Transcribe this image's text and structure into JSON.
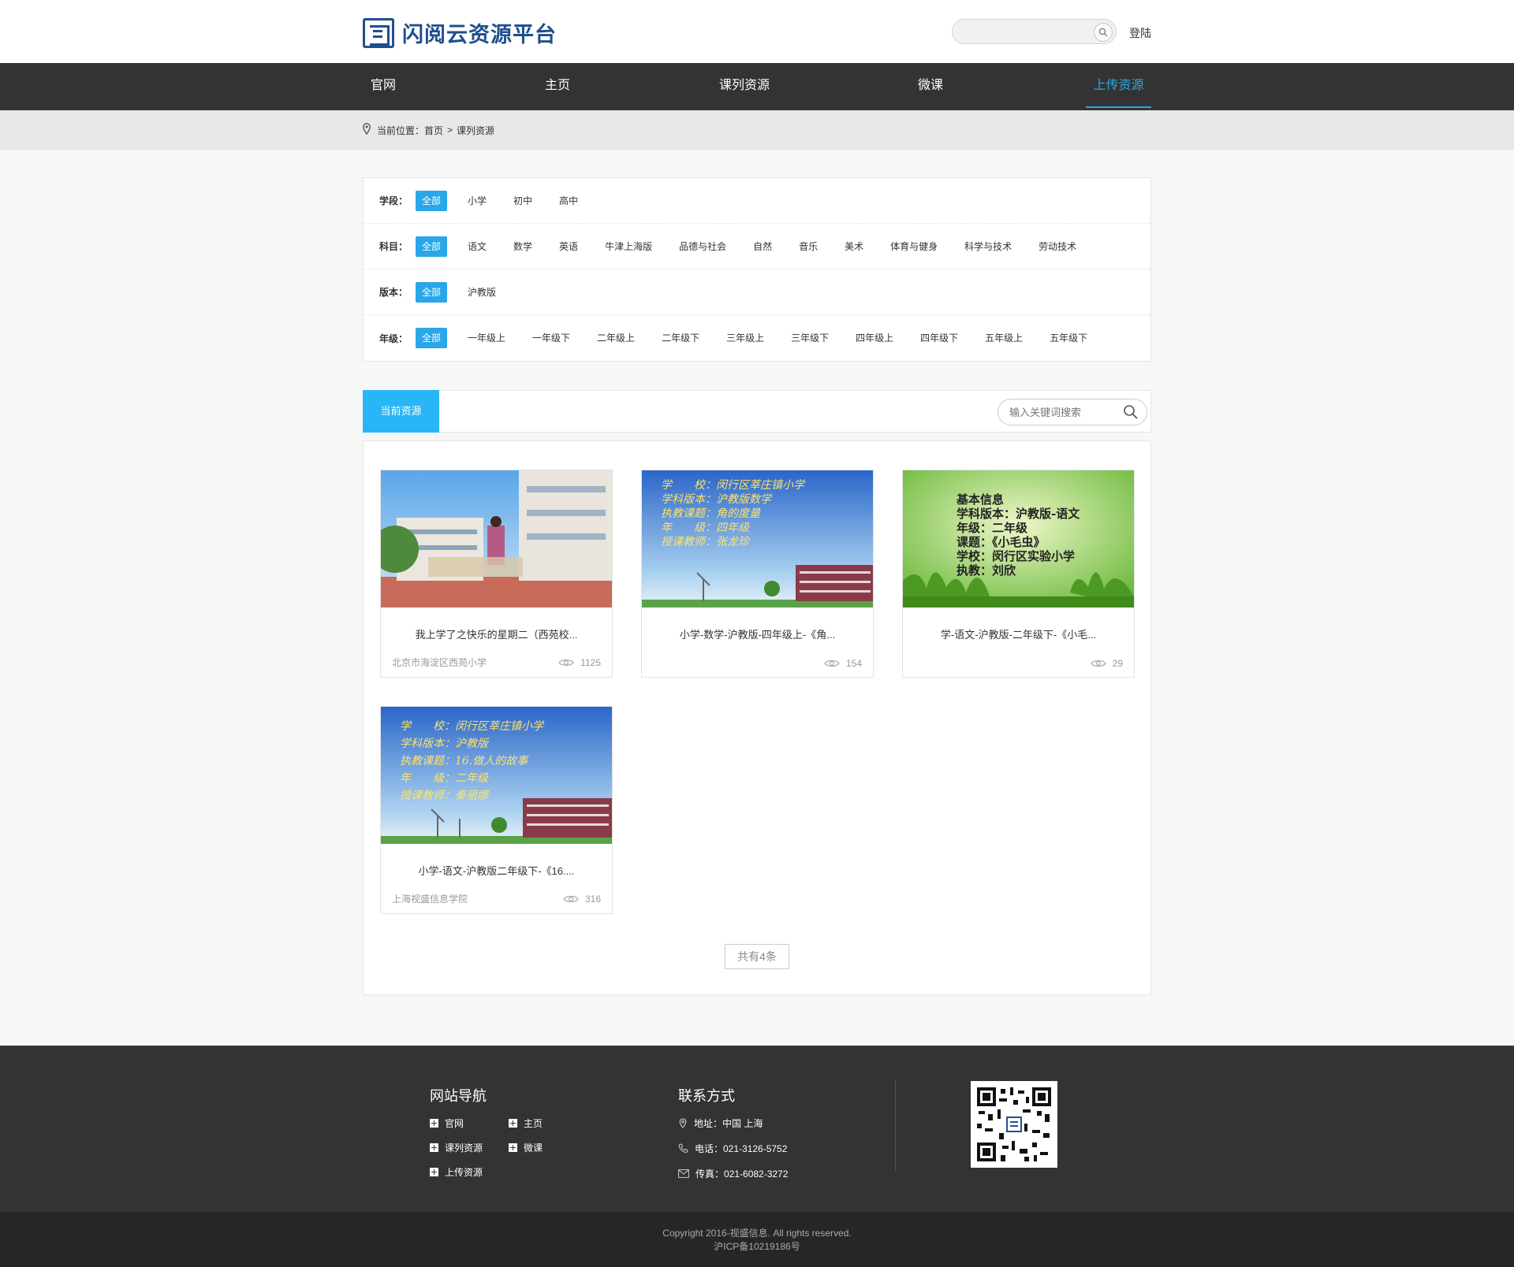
{
  "header": {
    "logo_text": "闪阅云资源平台",
    "search_placeholder": "",
    "login_label": "登陆"
  },
  "nav": {
    "items": [
      "官网",
      "主页",
      "课列资源",
      "微课",
      "上传资源"
    ],
    "active": "上传资源"
  },
  "breadcrumb": {
    "prefix": "当前位置：",
    "home": "首页",
    "separator": ">",
    "current": "课列资源"
  },
  "filters": {
    "stage": {
      "label": "学段：",
      "options": [
        "全部",
        "小学",
        "初中",
        "高中"
      ],
      "selected": "全部"
    },
    "subject": {
      "label": "科目：",
      "options": [
        "全部",
        "语文",
        "数学",
        "英语",
        "牛津上海版",
        "品德与社会",
        "自然",
        "音乐",
        "美术",
        "体育与健身",
        "科学与技术",
        "劳动技术"
      ],
      "selected": "全部"
    },
    "edition": {
      "label": "版本：",
      "options": [
        "全部",
        "沪教版"
      ],
      "selected": "全部"
    },
    "grade": {
      "label": "年级：",
      "options": [
        "全部",
        "一年级上",
        "一年级下",
        "二年级上",
        "二年级下",
        "三年级上",
        "三年级下",
        "四年级上",
        "四年级下",
        "五年级上",
        "五年级下"
      ],
      "selected": "全部"
    }
  },
  "resources": {
    "tab_label": "当前资源",
    "search_placeholder": "输入关键词搜索",
    "cards": [
      {
        "title": "我上学了之快乐的星期二（西苑校...",
        "school": "北京市海淀区西苑小学",
        "views": "1125",
        "thumb": "photo",
        "thumb_lines": []
      },
      {
        "title": "小学-数学-沪教版-四年级上-《角...",
        "school": "",
        "views": "154",
        "thumb": "sky",
        "thumb_lines": [
          "学　　校：闵行区莘庄镇小学",
          "学科版本：沪教版数学",
          "执教课题：角的度量",
          "年　　级：四年级",
          "授课教师：张龙珍"
        ]
      },
      {
        "title": "学-语文-沪教版-二年级下-《小毛...",
        "school": "",
        "views": "29",
        "thumb": "grass",
        "thumb_lines": [
          "基本信息",
          "学科版本：沪教版-语文",
          "年级：二年级",
          "课题：《小毛虫》",
          "学校：闵行区实验小学",
          "执教：刘欣"
        ]
      },
      {
        "title": "小学-语文-沪教版二年级下-《16....",
        "school": "上海视盛信息学院",
        "views": "316",
        "thumb": "sky",
        "thumb_lines": [
          "学　　校：闵行区莘庄镇小学",
          "学科版本：沪教版",
          "执教课题：16.做人的故事",
          "年　　级：二年级",
          "授课教师：秦丽娜"
        ]
      }
    ],
    "total": "共有4条"
  },
  "footer": {
    "nav_title": "网站导航",
    "nav_links": [
      "官网",
      "主页",
      "课列资源",
      "微课",
      "上传资源"
    ],
    "contact_title": "联系方式",
    "address": "地址：中国 上海",
    "phone": "电话：021-3126-5752",
    "fax": "传真：021-6082-3272",
    "copyright": "Copyright 2016-视盛信息. All rights reserved.",
    "icp": "沪ICP备10219186号"
  },
  "colors": {
    "accent": "#29a7e8",
    "nav_bg": "#333333",
    "brand": "#1f4f8e"
  }
}
